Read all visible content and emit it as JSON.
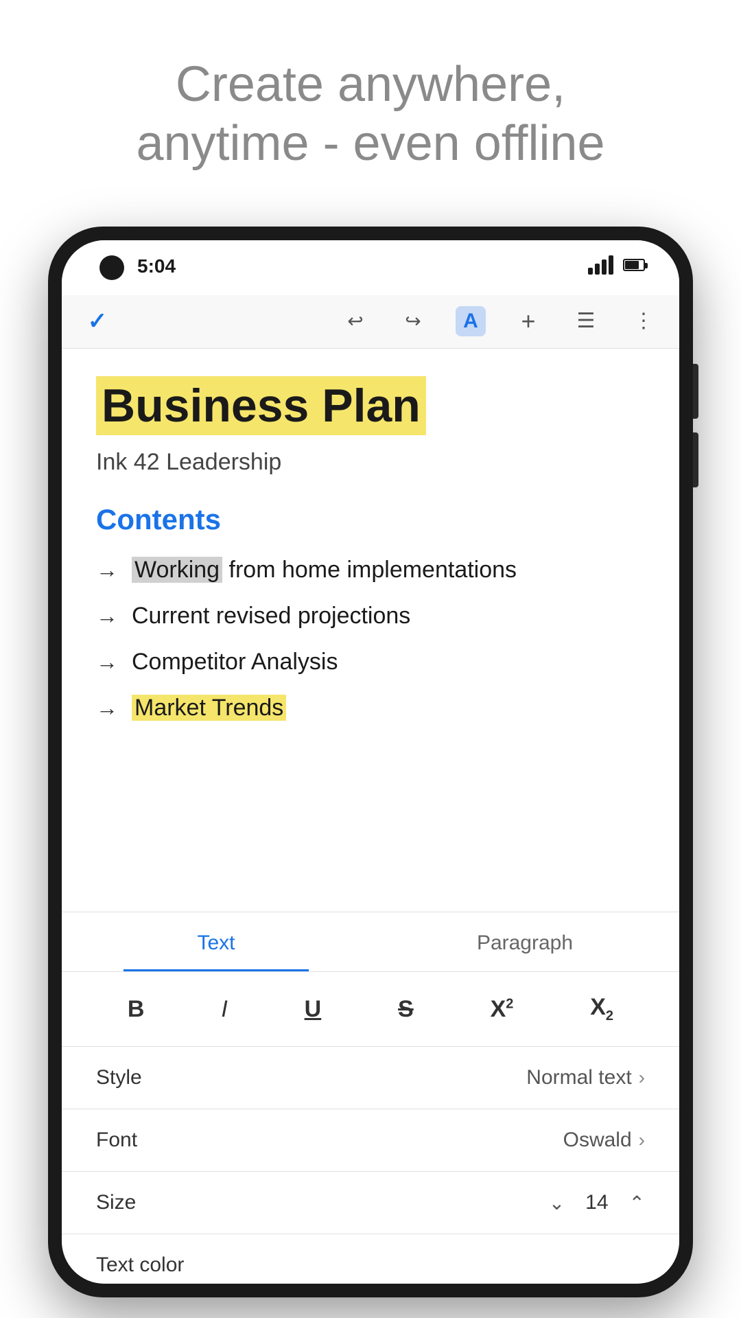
{
  "hero": {
    "line1": "Create anywhere,",
    "line2": "anytime - even offline"
  },
  "phone": {
    "status": {
      "time": "5:04"
    },
    "toolbar": {
      "check_icon": "✓",
      "undo_icon": "↩",
      "redo_icon": "↪",
      "text_format_icon": "A",
      "add_icon": "+",
      "comment_icon": "☰",
      "more_icon": "⋮"
    },
    "document": {
      "title": "Business Plan",
      "subtitle": "Ink 42 Leadership",
      "section": "Contents",
      "list_items": [
        {
          "text": "Working from home implementations",
          "highlight_word": "Working"
        },
        {
          "text": "Current revised projections",
          "highlight_word": ""
        },
        {
          "text": "Competitor Analysis",
          "highlight_word": ""
        },
        {
          "text": "Market Trends",
          "highlight_word": "Market Trends"
        }
      ]
    },
    "bottom_panel": {
      "tabs": [
        {
          "label": "Text",
          "active": true
        },
        {
          "label": "Paragraph",
          "active": false
        }
      ],
      "format_buttons": [
        {
          "label": "B",
          "type": "bold"
        },
        {
          "label": "I",
          "type": "italic"
        },
        {
          "label": "U",
          "type": "underline"
        },
        {
          "label": "S",
          "type": "strikethrough"
        },
        {
          "label": "X²",
          "type": "superscript"
        },
        {
          "label": "X₂",
          "type": "subscript"
        }
      ],
      "style_row": {
        "label": "Style",
        "value": "Normal text"
      },
      "font_row": {
        "label": "Font",
        "value": "Oswald"
      },
      "size_row": {
        "label": "Size",
        "value": "14"
      },
      "partial_row": {
        "label": "Text color"
      }
    }
  }
}
